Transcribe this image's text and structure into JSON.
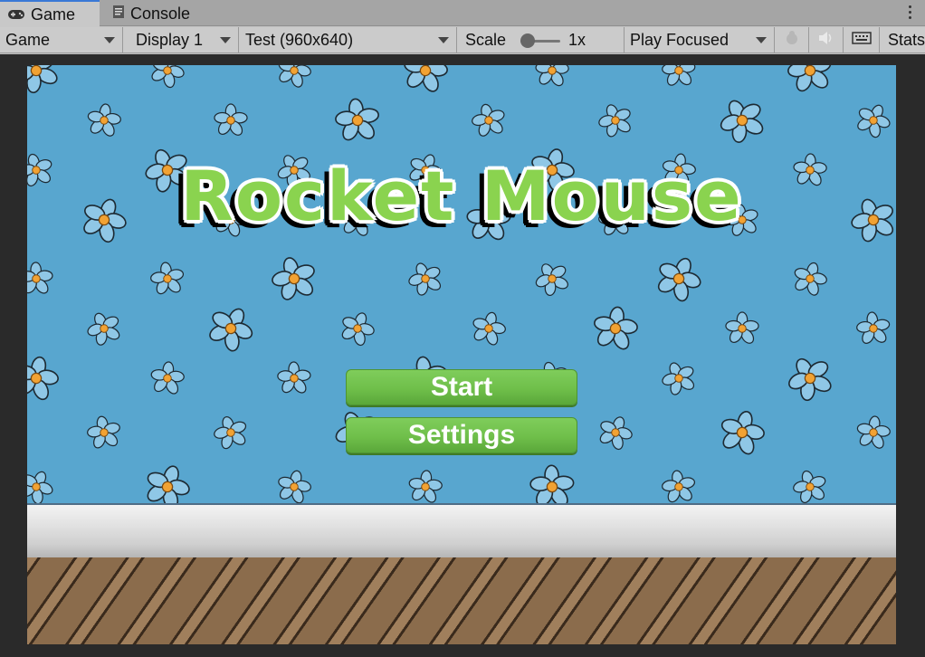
{
  "tabs": [
    {
      "label": "Game",
      "icon": "gamepad-icon",
      "active": true
    },
    {
      "label": "Console",
      "icon": "console-icon",
      "active": false
    }
  ],
  "toolbar": {
    "view_mode": "Game",
    "display": "Display 1",
    "resolution": "Test (960x640)",
    "scale_label": "Scale",
    "scale_value": "1x",
    "play_mode": "Play Focused",
    "stats_label": "Stats"
  },
  "game": {
    "title": "Rocket Mouse",
    "buttons": {
      "start": "Start",
      "settings": "Settings"
    }
  }
}
